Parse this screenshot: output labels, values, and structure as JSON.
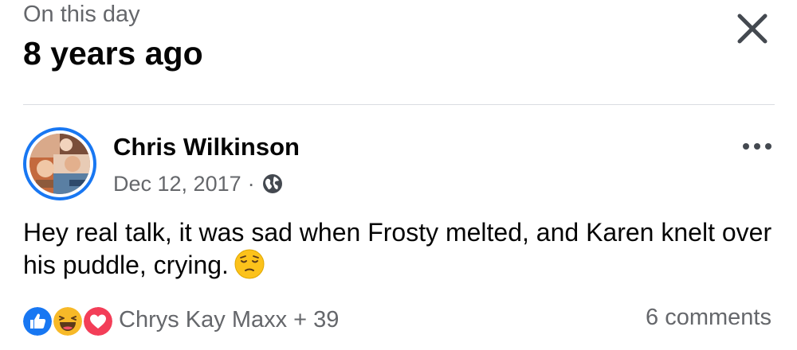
{
  "memory": {
    "kicker": "On this day",
    "headline": "8 years ago"
  },
  "post": {
    "author": "Chris Wilkinson",
    "date": "Dec 12, 2017",
    "separator": "·",
    "audience_icon": "globe-icon",
    "text": "Hey real talk, it was sad when Frosty melted, and Karen knelt over his puddle, crying.",
    "emoji": "pensive-face"
  },
  "engagement": {
    "reaction_icons": [
      "like",
      "haha",
      "love"
    ],
    "reactors": "Chrys Kay Maxx + 39",
    "comments": "6 comments"
  },
  "icons": {
    "close": "close-icon",
    "more": "more-options-icon"
  },
  "colors": {
    "accent_blue": "#1877f2",
    "secondary_text": "#65676b",
    "primary_text": "#050505",
    "love_red": "#f33e58",
    "haha_yellow": "#f7b928"
  }
}
